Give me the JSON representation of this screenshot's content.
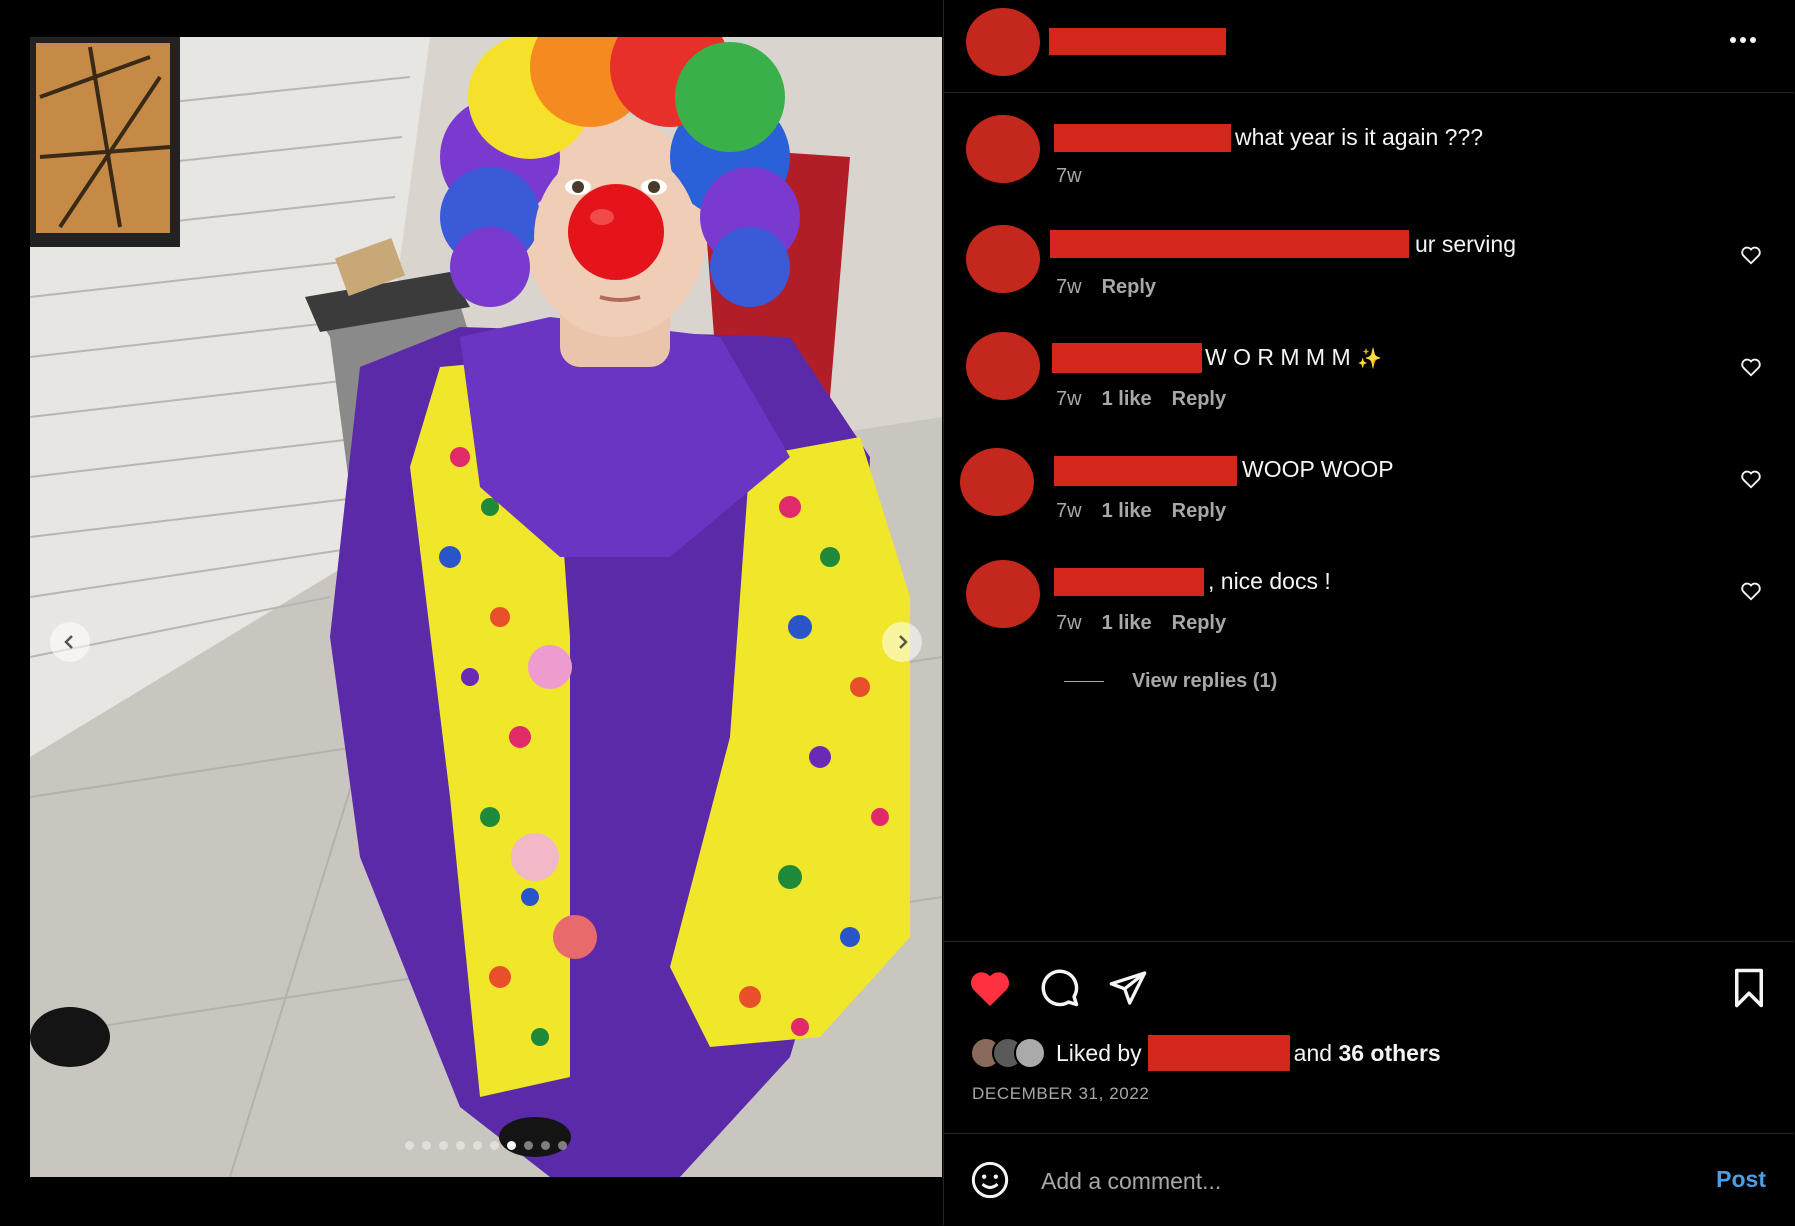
{
  "post": {
    "image_alt": "Person in rainbow clown wig, red nose and polka-dot clown costume",
    "carousel": {
      "total": 10,
      "active_index": 6
    },
    "date": "DECEMBER 31, 2022"
  },
  "comments": [
    {
      "text": "what year is it again ???",
      "time": "7w",
      "likes": "",
      "reply": ""
    },
    {
      "text": "ur serving",
      "time": "7w",
      "likes": "",
      "reply": "Reply"
    },
    {
      "text": "W O R M M M",
      "emoji": "✨",
      "time": "7w",
      "likes": "1 like",
      "reply": "Reply"
    },
    {
      "text": "WOOP WOOP",
      "time": "7w",
      "likes": "1 like",
      "reply": "Reply"
    },
    {
      "text": "nice docs !",
      "time": "7w",
      "likes": "1 like",
      "reply": "Reply"
    }
  ],
  "view_replies": "View replies (1)",
  "likes_bar": {
    "prefix": "Liked by",
    "suffix_and": "and",
    "others": "36 others"
  },
  "add_comment": {
    "placeholder": "Add a comment...",
    "post_label": "Post"
  },
  "colors": {
    "like_red": "#ff3040",
    "redaction": "#d4261a",
    "link_blue": "#4aa0e6"
  },
  "icons": [
    "more-icon",
    "heart-icon",
    "comment-icon",
    "share-icon",
    "bookmark-icon",
    "emoji-icon",
    "chevron-left-icon",
    "chevron-right-icon"
  ]
}
